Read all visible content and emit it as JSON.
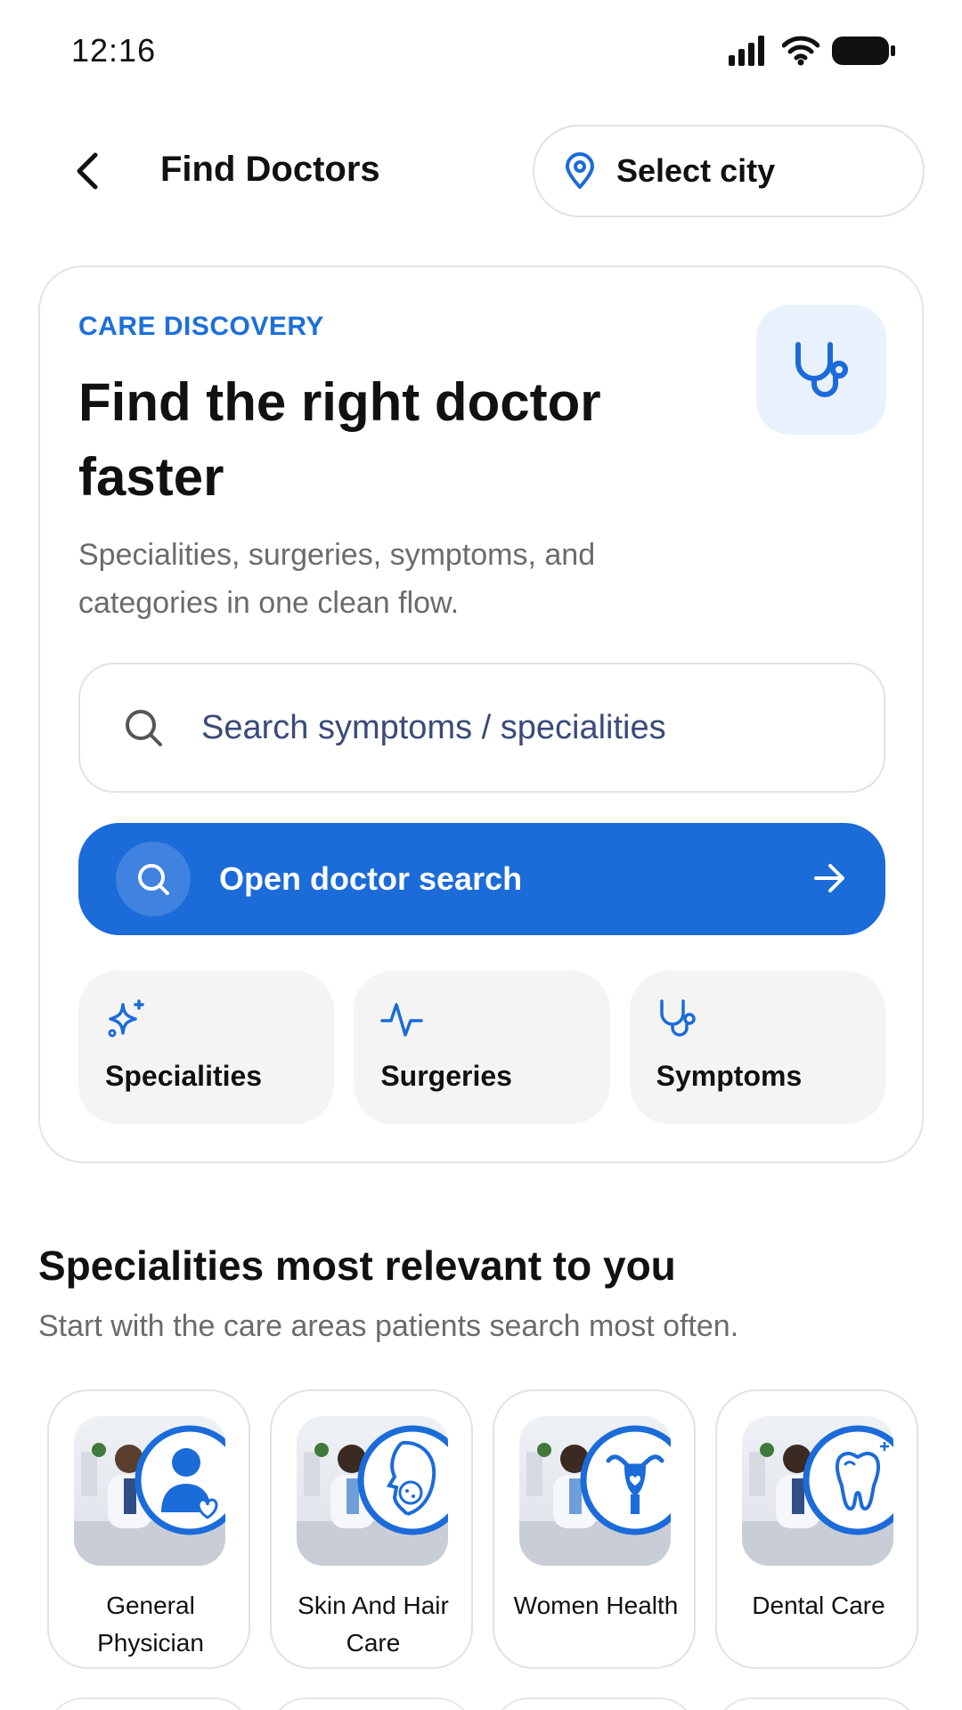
{
  "status_bar": {
    "time": "12:16"
  },
  "header": {
    "title": "Find Doctors",
    "city_label": "Select city"
  },
  "hero": {
    "eyebrow": "CARE DISCOVERY",
    "title": "Find the right doctor faster",
    "subtitle": "Specialities, surgeries, symptoms, and categories in one clean flow.",
    "search_placeholder": "Search symptoms / specialities",
    "cta_label": "Open doctor search",
    "chips": [
      {
        "label": "Specialities",
        "icon": "sparkle-icon"
      },
      {
        "label": "Surgeries",
        "icon": "pulse-icon"
      },
      {
        "label": "Symptoms",
        "icon": "stethoscope-icon"
      }
    ]
  },
  "section": {
    "title": "Specialities most relevant to you",
    "subtitle": "Start with the care areas patients search most often.",
    "items": [
      {
        "label": "General Physician",
        "icon": "doctor-heart-icon"
      },
      {
        "label": "Skin And Hair Care",
        "icon": "face-skin-icon"
      },
      {
        "label": "Women Health",
        "icon": "uterus-icon"
      },
      {
        "label": "Dental Care",
        "icon": "tooth-icon"
      }
    ]
  },
  "colors": {
    "accent": "#1b6bd9",
    "eyebrow": "#1d6fdc",
    "badge_bg": "#e9f1fc",
    "chip_bg": "#f4f4f4"
  }
}
